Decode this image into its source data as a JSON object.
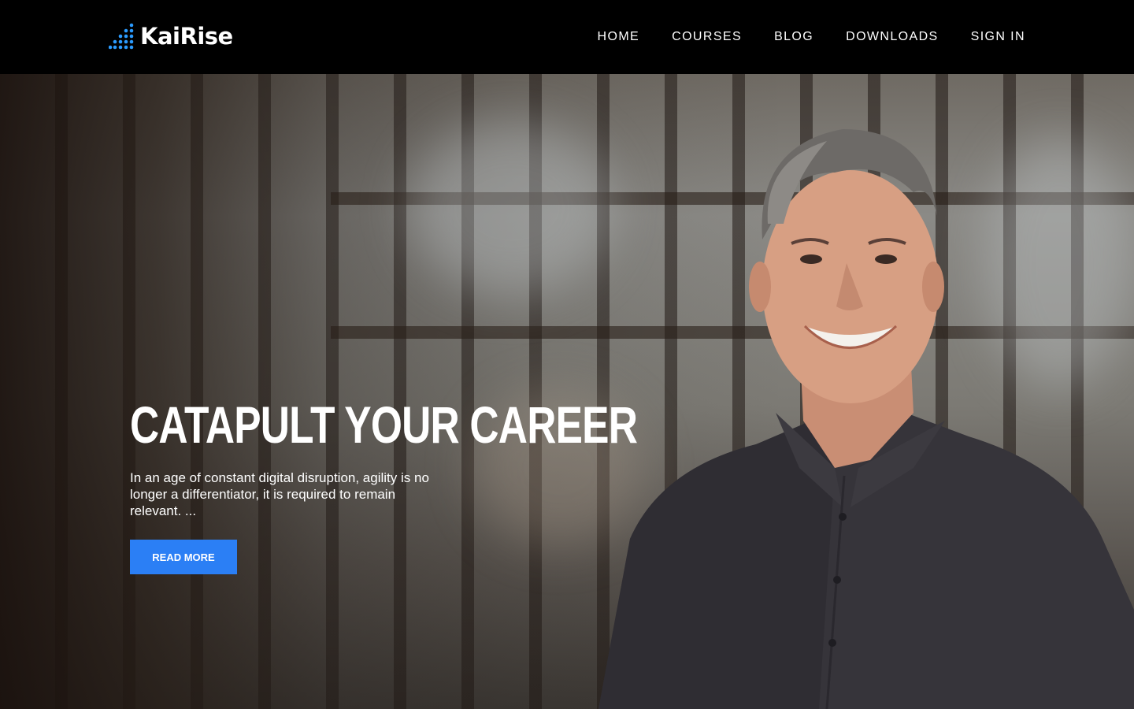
{
  "brand": {
    "name": "KaiRise",
    "accent": "#2b7ff5",
    "logo_dot_color": "#2b9bff"
  },
  "nav": {
    "items": [
      {
        "label": "HOME"
      },
      {
        "label": "COURSES"
      },
      {
        "label": "BLOG"
      },
      {
        "label": "DOWNLOADS"
      },
      {
        "label": "SIGN IN"
      }
    ]
  },
  "hero": {
    "title": "CATAPULT YOUR CAREER",
    "text": "In an age of constant digital disruption, agility is no longer a differentiator, it is required to remain relevant. ...",
    "button_label": "READ MORE"
  }
}
